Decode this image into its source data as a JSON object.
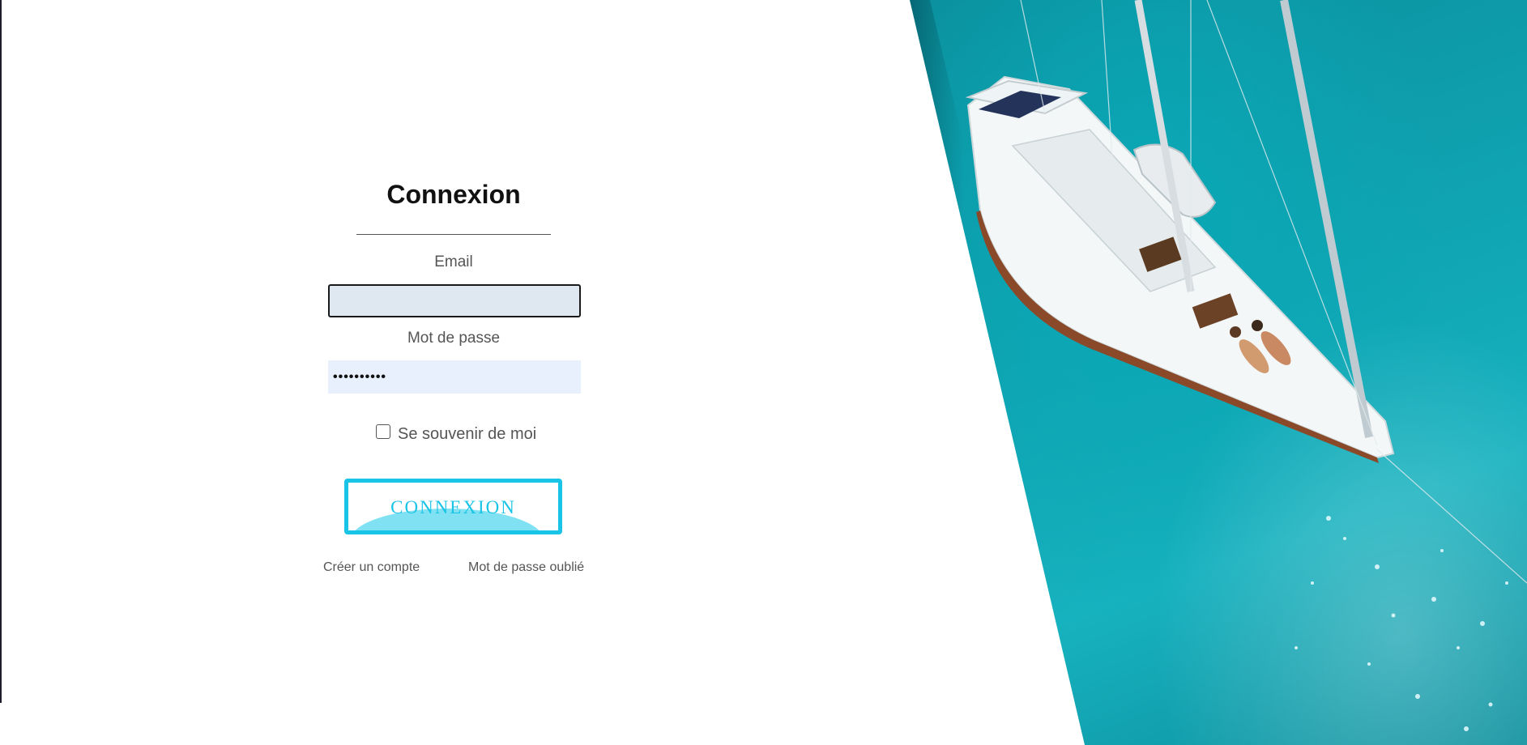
{
  "login": {
    "title": "Connexion",
    "email_label": "Email",
    "email_value": "",
    "email_placeholder": "",
    "password_label": "Mot de passe",
    "password_value": "••••••••••",
    "remember_label": "Se souvenir de moi",
    "remember_checked": false,
    "submit_label": "CONNEXION",
    "create_account_link": "Créer un compte",
    "forgot_password_link": "Mot de passe oublié"
  },
  "hero": {
    "image": "aerial-sailboat-turquoise-sea"
  },
  "colors": {
    "accent": "#19c4e6",
    "accent_light": "#7fe1f1",
    "sea": "#10a5b3",
    "email_bg": "#dfe8f0",
    "autofill_bg": "#e8f0fe",
    "text": "#555555",
    "title": "#111111"
  }
}
